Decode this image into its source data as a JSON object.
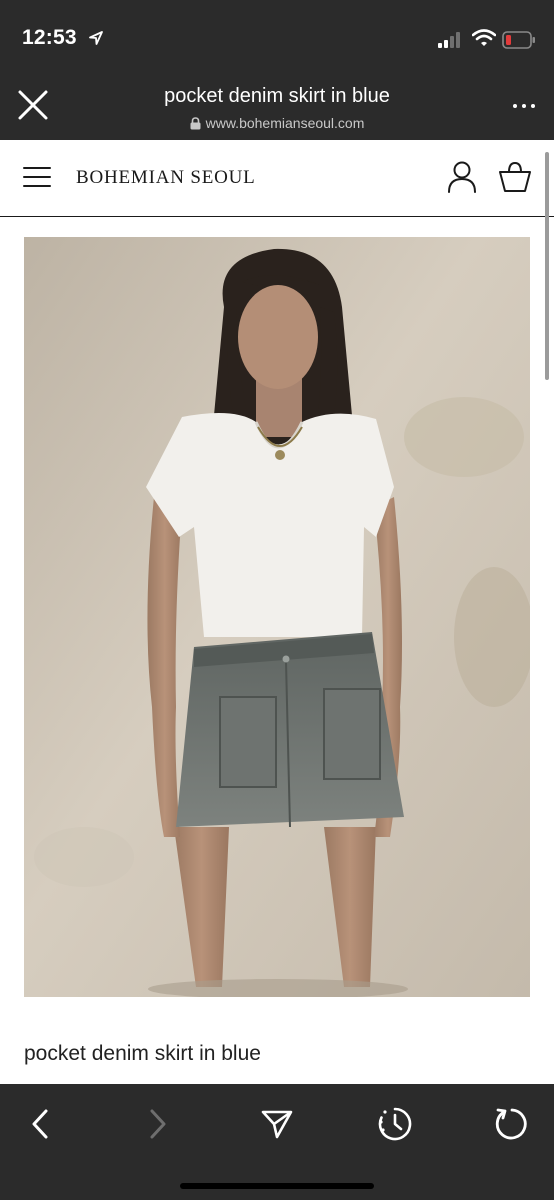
{
  "status": {
    "time": "12:53",
    "icons": [
      "location-arrow-icon",
      "signal-icon",
      "wifi-icon",
      "battery-low-icon"
    ]
  },
  "browser": {
    "title": "pocket denim skirt in blue",
    "url": "www.bohemianseoul.com",
    "close_icon": "close-icon",
    "more_icon": "more-dots-icon",
    "lock_icon": "lock-icon"
  },
  "site": {
    "brand": "BOHEMIAN SEOUL",
    "menu_icon": "hamburger-icon",
    "account_icon": "account-icon",
    "cart_icon": "cart-icon"
  },
  "product": {
    "name": "pocket denim skirt in blue",
    "image_alt": "Model wearing white scoop-neck tee and grey-blue pocket denim mini skirt"
  },
  "toolbar": {
    "buttons": [
      "back-icon",
      "forward-icon",
      "share-icon",
      "history-icon",
      "reload-icon"
    ]
  },
  "colors": {
    "chrome": "#2b2b2b",
    "battery_low": "#e23b3b",
    "text": "#222222"
  }
}
